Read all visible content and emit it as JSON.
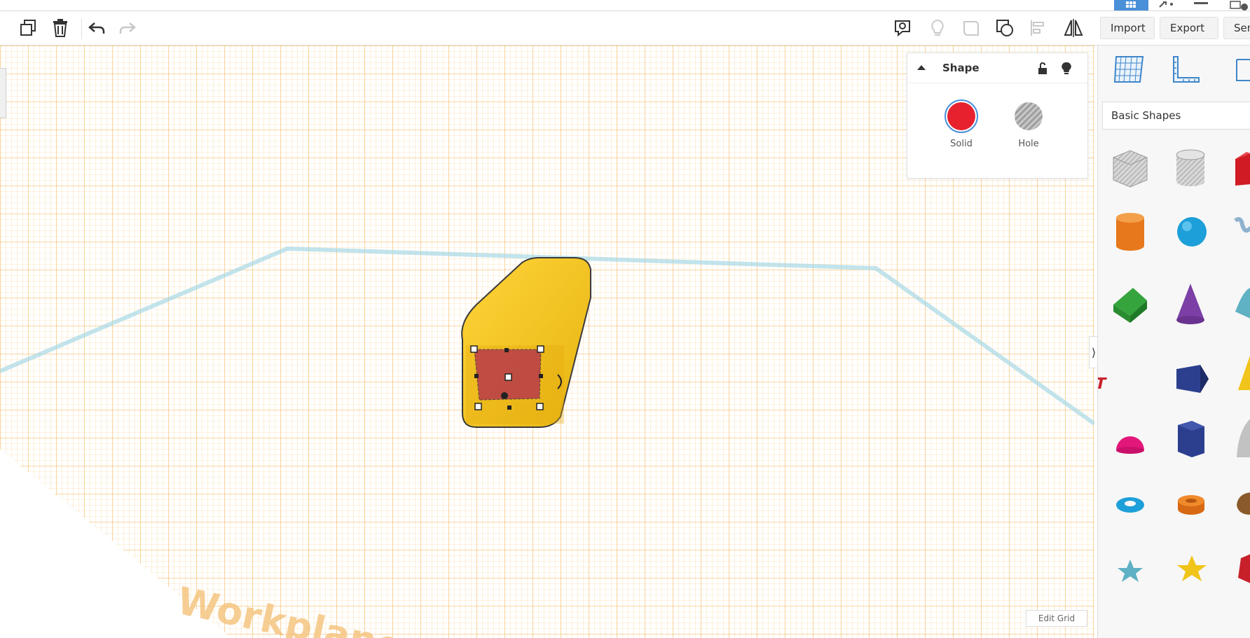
{
  "toolbar": {
    "import_label": "Import",
    "export_label": "Export",
    "send_label": "Sen"
  },
  "shape_panel": {
    "title": "Shape",
    "solid_label": "Solid",
    "hole_label": "Hole",
    "solid_color": "#e8212f"
  },
  "workplane": {
    "watermark": "Workplane",
    "edit_grid_label": "Edit Grid",
    "grid_color": "#f2b04a",
    "shape_color": "#f5c518"
  },
  "sidebar": {
    "library_label": "Basic Shapes"
  },
  "colors": {
    "accent": "#4a90d9",
    "grid_line": "#f5c27a",
    "workplane_border": "#a8d8e6"
  }
}
